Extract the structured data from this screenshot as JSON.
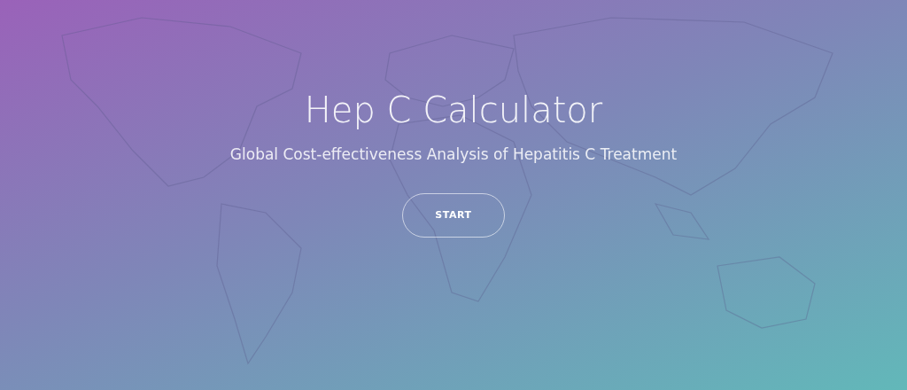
{
  "hero": {
    "title": "Hep C Calculator",
    "subtitle": "Global Cost-effectiveness Analysis of Hepatitis C Treatment",
    "start_button": {
      "label": "START"
    }
  }
}
